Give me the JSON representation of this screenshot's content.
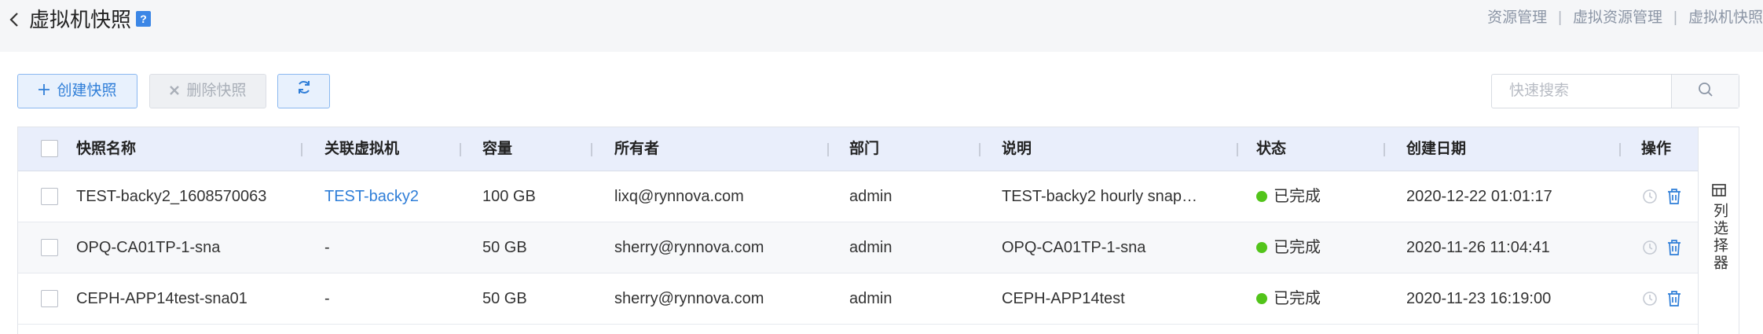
{
  "header": {
    "title": "虚拟机快照",
    "help_label": "?",
    "breadcrumb": [
      "资源管理",
      "虚拟资源管理",
      "虚拟机快照"
    ],
    "breadcrumb_separator": "|"
  },
  "toolbar": {
    "create_label": "创建快照",
    "delete_label": "删除快照",
    "icons": {
      "create": "plus-icon",
      "delete": "x-icon",
      "refresh": "refresh-icon"
    }
  },
  "search": {
    "placeholder": "快速搜索",
    "value": "",
    "icon": "search-icon"
  },
  "table": {
    "columns": [
      "快照名称",
      "关联虚拟机",
      "容量",
      "所有者",
      "部门",
      "说明",
      "状态",
      "创建日期",
      "操作"
    ],
    "rows": [
      {
        "name": "TEST-backy2_1608570063",
        "vm": "TEST-backy2",
        "capacity": "100 GB",
        "owner": "lixq@rynnova.com",
        "department": "admin",
        "description": "TEST-backy2 hourly snap…",
        "status": "已完成",
        "created": "2020-12-22 01:01:17"
      },
      {
        "name": "OPQ-CA01TP-1-sna",
        "vm": "-",
        "capacity": "50 GB",
        "owner": "sherry@rynnova.com",
        "department": "admin",
        "description": "OPQ-CA01TP-1-sna",
        "status": "已完成",
        "created": "2020-11-26 11:04:41"
      },
      {
        "name": "CEPH-APP14test-sna01",
        "vm": "-",
        "capacity": "50 GB",
        "owner": "sherry@rynnova.com",
        "department": "admin",
        "description": "CEPH-APP14test",
        "status": "已完成",
        "created": "2020-11-23 16:19:00"
      }
    ],
    "row_actions": [
      "restore-icon",
      "trash-icon"
    ]
  },
  "column_selector": {
    "label": "列选择器",
    "icon": "columns-icon"
  },
  "colors": {
    "accent": "#2f7ed8",
    "status_done": "#52c41a",
    "header_bg": "#e9eefb",
    "page_header_bg": "#f5f6f8"
  }
}
